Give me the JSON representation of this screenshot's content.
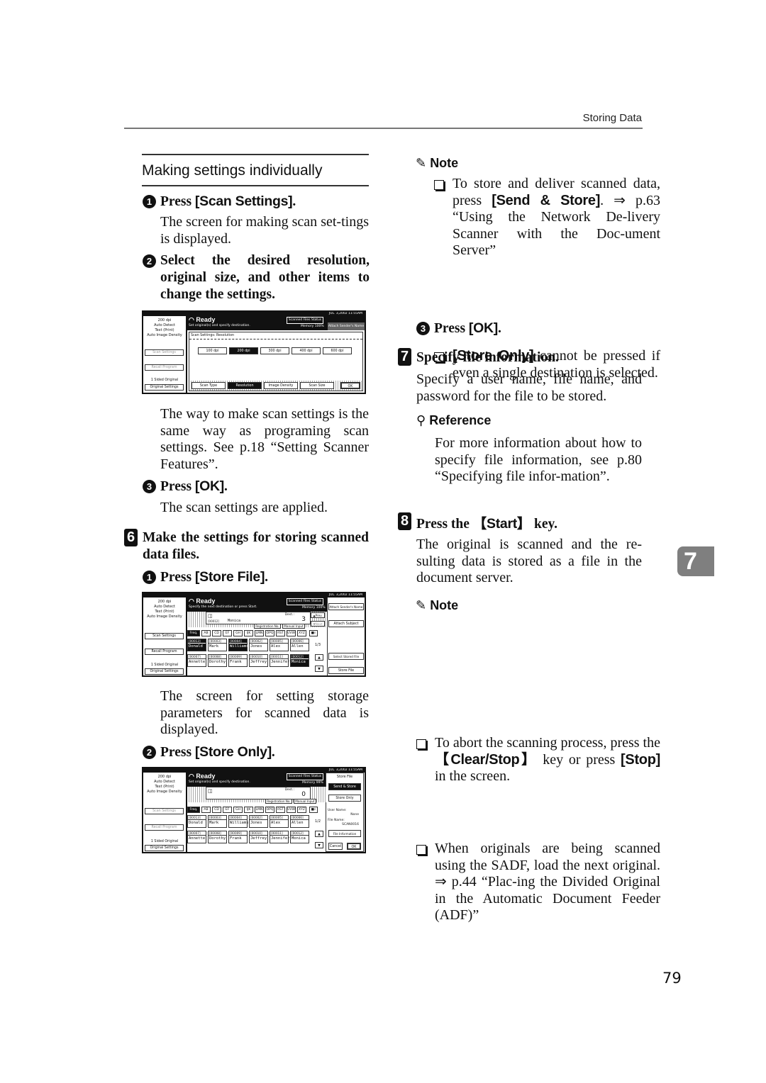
{
  "header": {
    "title": "Storing Data"
  },
  "section_title": "Making settings individually",
  "left": {
    "s1": {
      "num": "1",
      "prefix": "Press ",
      "button": "[Scan Settings]",
      "suffix": ".",
      "text": "The screen for making scan set-tings is displayed."
    },
    "s2": {
      "num": "2",
      "text": "Select the desired resolution, original size, and other items to change the settings."
    },
    "after_panel1": "The way to make scan settings is the same way as programing scan settings. See p.18 “Setting Scanner Features”.",
    "s3": {
      "num": "3",
      "prefix": "Press ",
      "button": "[OK]",
      "suffix": ".",
      "text": "The scan settings are applied."
    },
    "step6": {
      "num": "6",
      "text": "Make the settings for storing scanned data files."
    },
    "s6_1": {
      "num": "1",
      "prefix": "Press ",
      "button": "[Store File]",
      "suffix": "."
    },
    "after_panel2": "The screen for setting storage parameters for scanned data is displayed.",
    "s6_2": {
      "num": "2",
      "prefix": "Press ",
      "button": "[Store Only]",
      "suffix": "."
    }
  },
  "right": {
    "note1": {
      "heading": "Note",
      "items": [
        {
          "pre": "To store and deliver scanned data, press ",
          "button": "[Send & Store]",
          "post": ". ⇒ p.63 “Using the Network De-livery Scanner with the Doc-ument Server”"
        },
        {
          "pre": "",
          "button": "[Store Only]",
          "post": " cannot be pressed if even a single destination is selected."
        }
      ]
    },
    "s3": {
      "num": "3",
      "prefix": "Press ",
      "button": "[OK]",
      "suffix": "."
    },
    "step7": {
      "num": "7",
      "title": "Specify file information.",
      "text": "Specify a user name, file name, and password for the file to be stored."
    },
    "reference": {
      "heading": "Reference",
      "text": "For more information about how to specify file information, see p.80 “Specifying file infor-mation”."
    },
    "step8": {
      "num": "8",
      "pre": "Press the ",
      "key": "【Start】",
      "post": " key.",
      "text": "The original is scanned and the re-sulting data is stored as a file in the document server."
    },
    "note2": {
      "heading": "Note",
      "items": [
        {
          "pre": "To abort the scanning process, press the ",
          "key": "【Clear/Stop】",
          "mid": " key or press ",
          "button": "[Stop]",
          "post": " in the screen."
        },
        {
          "text": "When originals are being scanned using the SADF, load the next original. ⇒ p.44 “Plac-ing the Divided Original in the Automatic Document Feeder (ADF)”"
        }
      ]
    }
  },
  "chapter_tab": "7",
  "page_number": "79",
  "panels": {
    "common": {
      "date": "JUL.  3,2002 11:55AM",
      "info": [
        "200 dpi",
        "Auto Detect",
        "Text (Print)",
        "Auto Image Density"
      ],
      "ready": "Ready",
      "scan_settings": "Scan Settings",
      "recall_program": "Recall Program",
      "sided": "1 Sided Original",
      "original_settings": "Original Settings",
      "scanned_files_status": "Scanned Files Status",
      "attach_sender": "Attach Sender's Name",
      "attach_subject": "Attach Subject"
    },
    "p1": {
      "sub": "Set original(s) and specify destination.",
      "memory": "Memory 100%",
      "heading": "Scan Settings: Resolution",
      "resolutions": [
        "100 dpi",
        "200 dpi",
        "300 dpi",
        "400 dpi",
        "600 dpi"
      ],
      "selected_resolution": 1,
      "tabs": [
        "Scan Type",
        "Resolution",
        "Image Density",
        "Scan Size"
      ],
      "selected_tab": 1,
      "ok": "OK"
    },
    "p2": {
      "sub": "Specify the next destination or press Start.",
      "memory": "Memory 100%",
      "dest_label": "Dest.:",
      "dest_count": "3",
      "dest_id": "[00012]",
      "dest_name": "Monica",
      "prev": "▲Prev.",
      "next": "▼Next",
      "registration_no": "Registration No.",
      "manual_input": "Manual Input",
      "index_tabs": [
        "Freq.",
        "AB",
        "CD",
        "EF",
        "GH",
        "IJK",
        "LMN",
        "OPQ",
        "RST",
        "UVW",
        "XYZ"
      ],
      "row1": [
        {
          "id": "[00013]",
          "name": "Donald",
          "sel": true
        },
        {
          "id": "[00003]",
          "name": "Mark",
          "sel": false
        },
        {
          "id": "[00004]",
          "name": "Williams",
          "sel": true
        },
        {
          "id": "[00002]",
          "name": "Jones",
          "sel": false
        },
        {
          "id": "[00005]",
          "name": "Alex",
          "sel": false
        },
        {
          "id": "[00006]",
          "name": "Allen",
          "sel": false
        }
      ],
      "row2": [
        {
          "id": "[00007]",
          "name": "Annette",
          "sel": false
        },
        {
          "id": "[00008]",
          "name": "Dorothy",
          "sel": false
        },
        {
          "id": "[00009]",
          "name": "Frank",
          "sel": false
        },
        {
          "id": "[00010]",
          "name": "Jeffrey",
          "sel": false
        },
        {
          "id": "[00011]",
          "name": "Jennifer",
          "sel": false
        },
        {
          "id": "[00012]",
          "name": "Monica",
          "sel": true
        }
      ],
      "page": "1/3",
      "select_stored_file": "Select Stored File",
      "store_file": "Store File"
    },
    "p3": {
      "sub": "Set original(s) and specify destination.",
      "memory": "Memory 99%",
      "dest_count": "0",
      "page": "1/2",
      "store_file": "Store File",
      "send_store": "Send & Store",
      "store_only": "Store Only",
      "user_name_label": "User Name:",
      "user_name": "None",
      "file_name_label": "File Name:",
      "file_name": "SCAN0016",
      "file_information": "File Information",
      "cancel": "Cancel",
      "ok": "OK"
    }
  }
}
